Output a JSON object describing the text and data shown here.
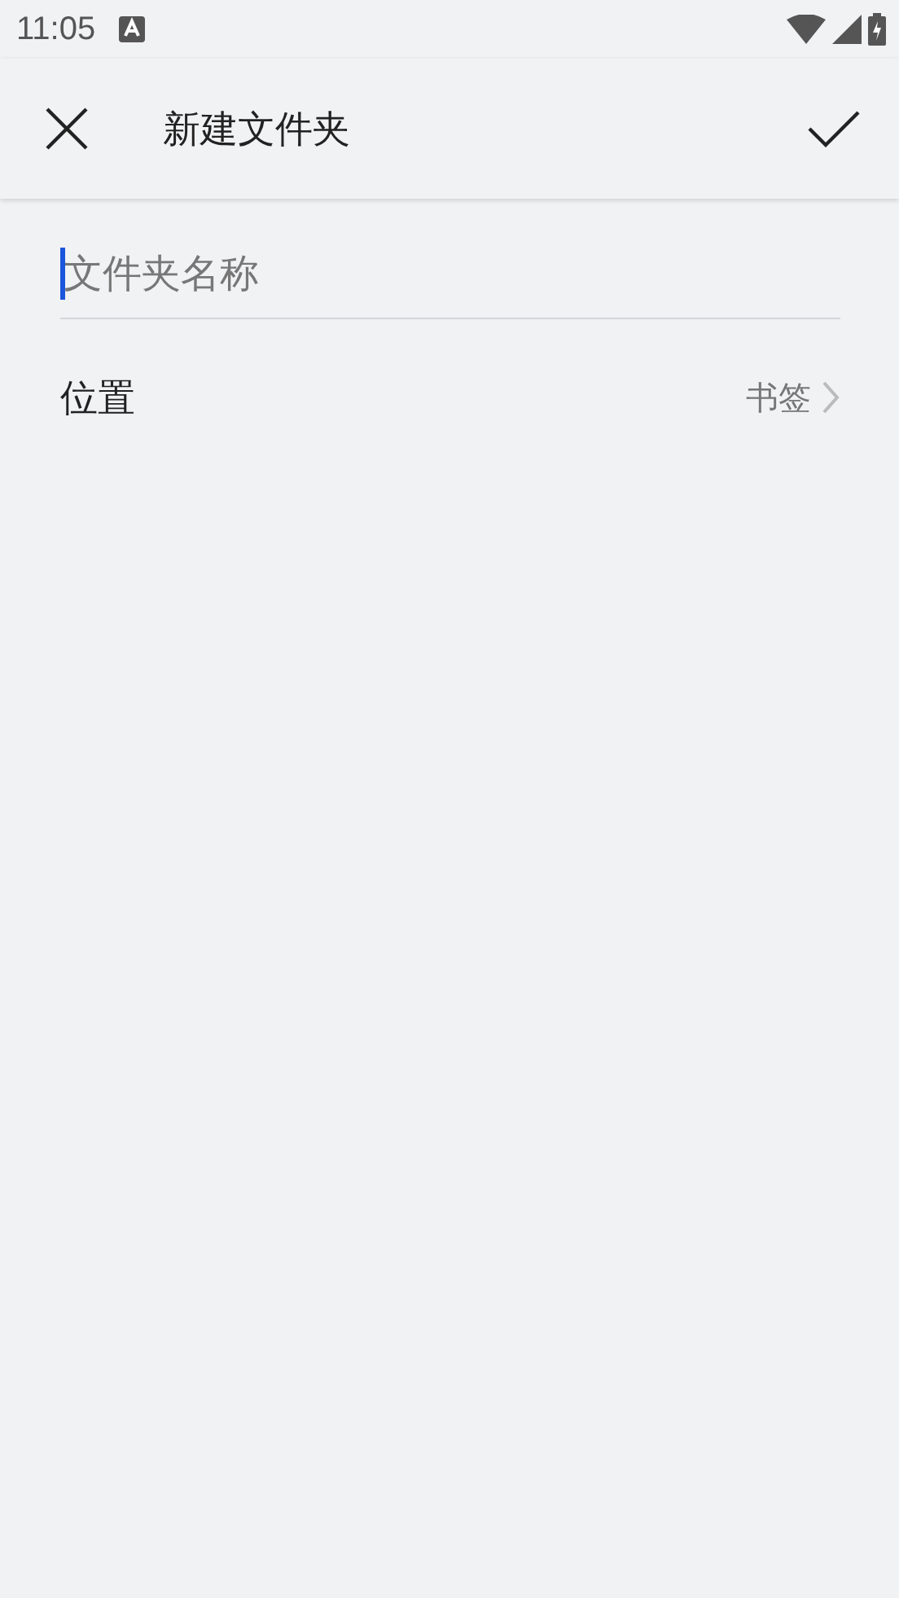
{
  "status_bar": {
    "time": "11:05"
  },
  "app_bar": {
    "title": "新建文件夹"
  },
  "name_field": {
    "placeholder": "文件夹名称"
  },
  "location": {
    "label": "位置",
    "value": "书签"
  }
}
